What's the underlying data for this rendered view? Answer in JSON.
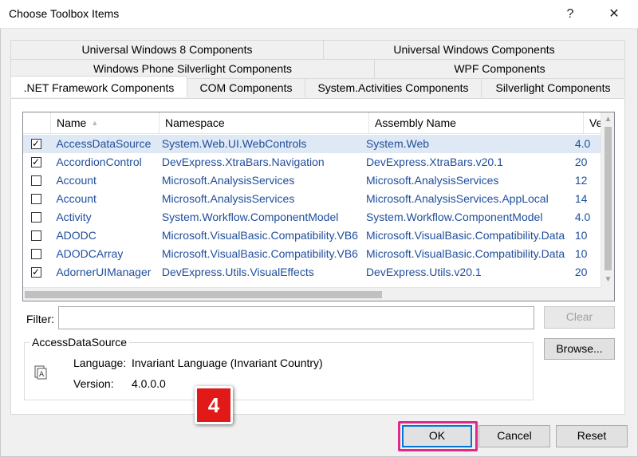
{
  "window": {
    "title": "Choose Toolbox Items",
    "help_glyph": "?",
    "close_glyph": "✕"
  },
  "tabs": {
    "row1": [
      "Universal Windows 8 Components",
      "Universal Windows Components"
    ],
    "row2": [
      "Windows Phone Silverlight Components",
      "WPF Components"
    ],
    "row3": [
      ".NET Framework Components",
      "COM Components",
      "System.Activities Components",
      "Silverlight Components"
    ],
    "active": ".NET Framework Components"
  },
  "grid": {
    "columns": [
      "Name",
      "Namespace",
      "Assembly Name",
      "Ve"
    ],
    "sorted_column": "Name",
    "rows": [
      {
        "checked": true,
        "name": "AccessDataSource",
        "namespace": "System.Web.UI.WebControls",
        "assembly": "System.Web",
        "version": "4.0",
        "selected": true
      },
      {
        "checked": true,
        "name": "AccordionControl",
        "namespace": "DevExpress.XtraBars.Navigation",
        "assembly": "DevExpress.XtraBars.v20.1",
        "version": "20"
      },
      {
        "checked": false,
        "name": "Account",
        "namespace": "Microsoft.AnalysisServices",
        "assembly": "Microsoft.AnalysisServices",
        "version": "12"
      },
      {
        "checked": false,
        "name": "Account",
        "namespace": "Microsoft.AnalysisServices",
        "assembly": "Microsoft.AnalysisServices.AppLocal",
        "version": "14"
      },
      {
        "checked": false,
        "name": "Activity",
        "namespace": "System.Workflow.ComponentModel",
        "assembly": "System.Workflow.ComponentModel",
        "version": "4.0"
      },
      {
        "checked": false,
        "name": "ADODC",
        "namespace": "Microsoft.VisualBasic.Compatibility.VB6",
        "assembly": "Microsoft.VisualBasic.Compatibility.Data",
        "version": "10"
      },
      {
        "checked": false,
        "name": "ADODCArray",
        "namespace": "Microsoft.VisualBasic.Compatibility.VB6",
        "assembly": "Microsoft.VisualBasic.Compatibility.Data",
        "version": "10"
      },
      {
        "checked": true,
        "name": "AdornerUIManager",
        "namespace": "DevExpress.Utils.VisualEffects",
        "assembly": "DevExpress.Utils.v20.1",
        "version": "20"
      }
    ]
  },
  "filter": {
    "label": "Filter:",
    "value": "",
    "clear_label": "Clear"
  },
  "browse_label": "Browse...",
  "details": {
    "group_title": "AccessDataSource",
    "language_label": "Language:",
    "language_value": "Invariant Language (Invariant Country)",
    "version_label": "Version:",
    "version_value": "4.0.0.0"
  },
  "buttons": {
    "ok": "OK",
    "cancel": "Cancel",
    "reset": "Reset"
  },
  "callout": {
    "step_number": "4",
    "badge_color": "#e11919",
    "highlight_color": "#e0288d"
  }
}
